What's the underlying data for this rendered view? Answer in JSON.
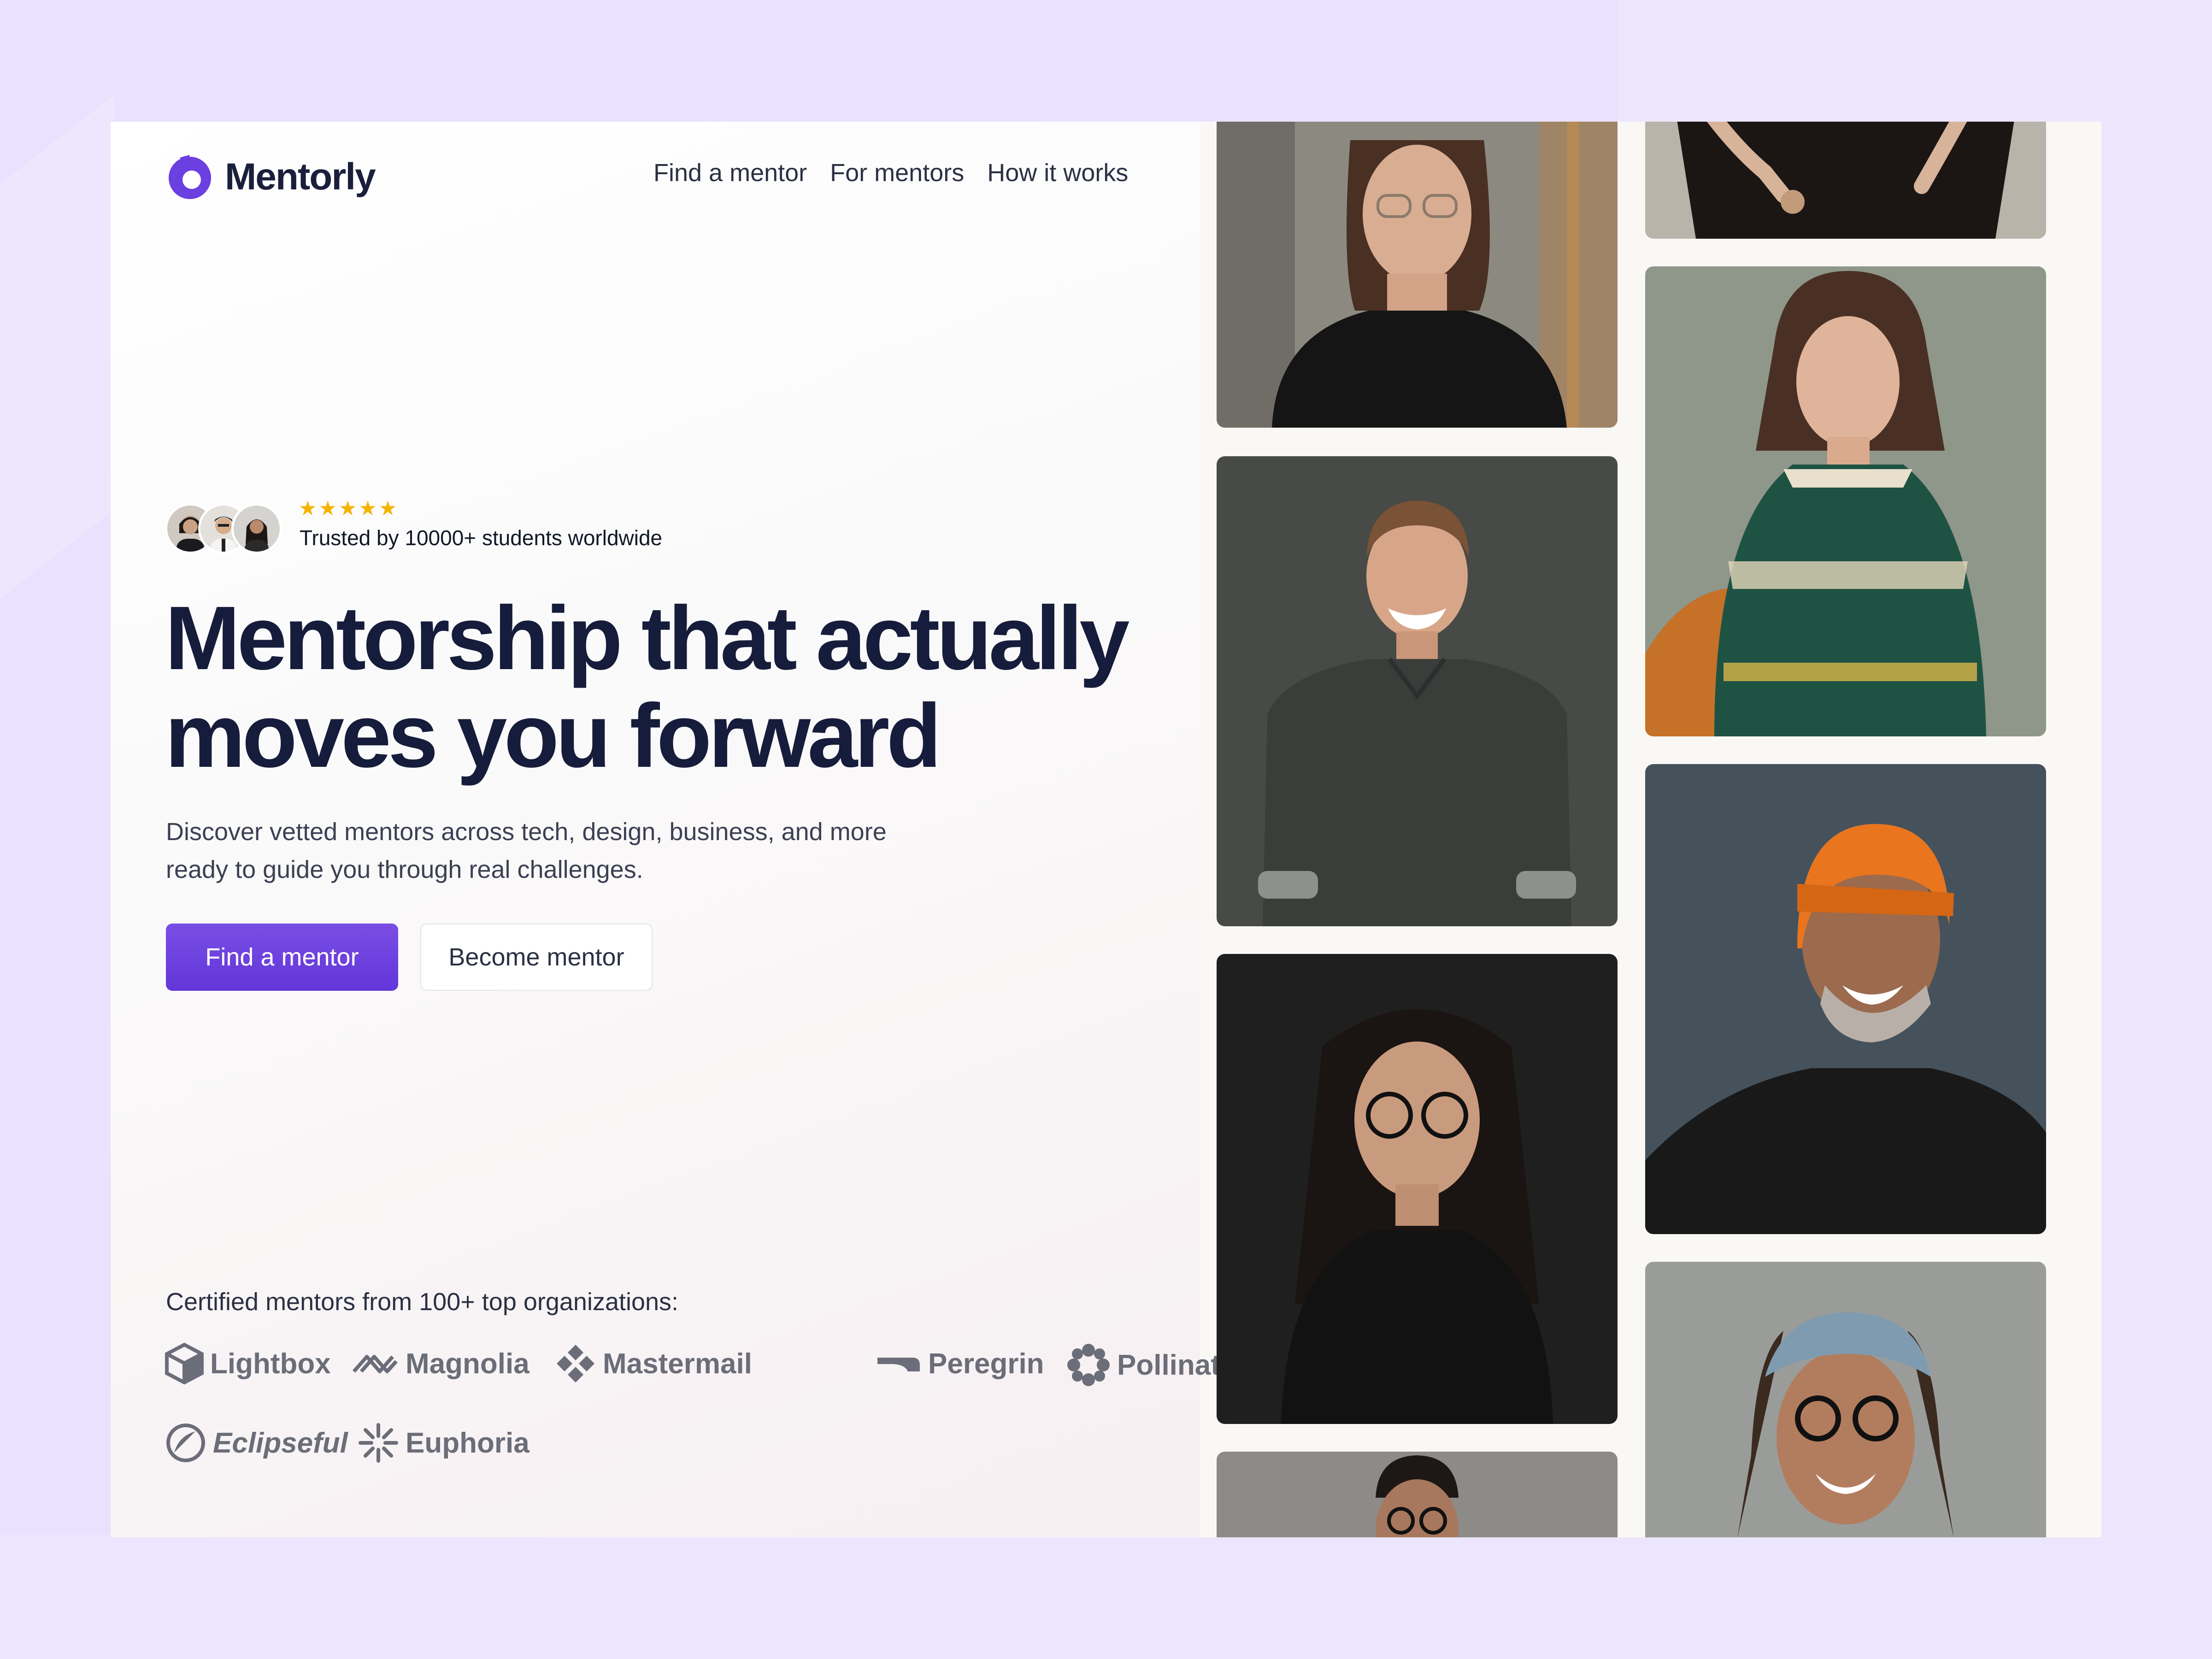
{
  "brand": {
    "name": "Mentorly",
    "accent": "#6b3fe0"
  },
  "nav": {
    "items": [
      "Find a mentor",
      "For mentors",
      "How it works"
    ]
  },
  "trust": {
    "rating_stars": 5,
    "text": "Trusted by 10000+ students worldwide"
  },
  "hero": {
    "headline_line1": "Mentorship that actually",
    "headline_line2": "moves you forward",
    "subtitle_line1": "Discover vetted mentors across tech, design, business, and more",
    "subtitle_line2": "ready to guide you through real challenges.",
    "primary_button": "Find a mentor",
    "secondary_button": "Become mentor"
  },
  "organizations": {
    "caption": "Certified mentors from 100+ top organizations:",
    "names": [
      "Lightbox",
      "Magnolia",
      "Mastermail",
      "Peregrin",
      "Pollinate",
      "Eclipseful",
      "Euphoria"
    ]
  },
  "mentor_photos": {
    "column1": [
      "woman with glasses and curly hair",
      "smiling man in dark shirt",
      "woman with glasses and long dark hair",
      "man with glasses"
    ],
    "column2": [
      "person in black top",
      "woman in green sweater",
      "smiling man in orange beanie",
      "smiling man in cap with glasses"
    ]
  },
  "colors": {
    "headline": "#161c3b",
    "star": "#f5b301",
    "org_logo": "#6b6e78"
  }
}
